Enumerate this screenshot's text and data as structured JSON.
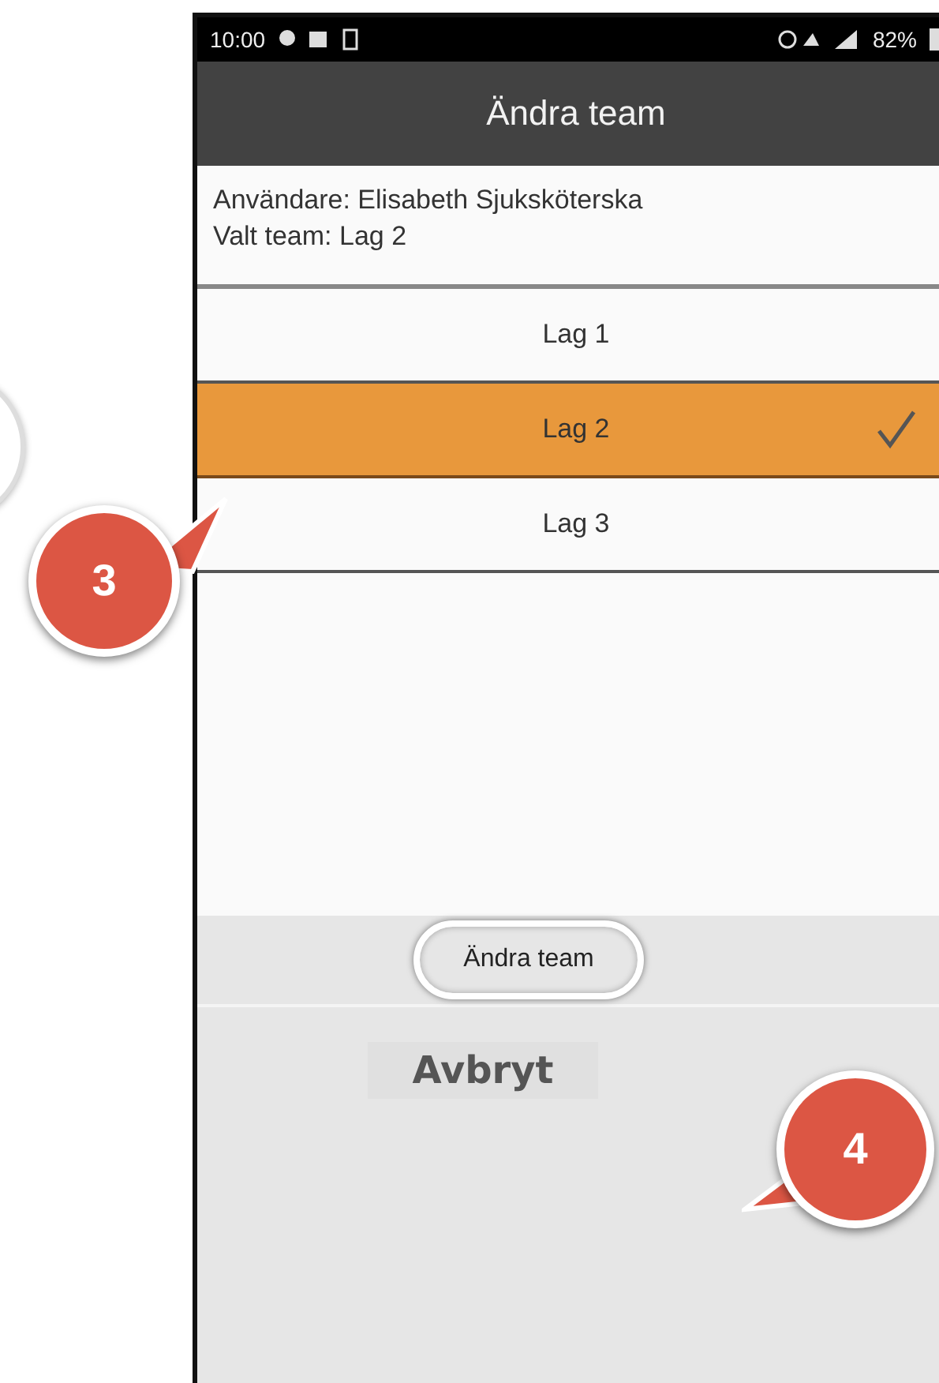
{
  "status_bar": {
    "time": "10:00",
    "battery": "82%"
  },
  "title_bar": {
    "title": "Ändra team"
  },
  "info": {
    "user": "Användare: Elisabeth Sjuksköterska",
    "team": "Valt team: Lag 2"
  },
  "teams": [
    {
      "label": "Lag 1",
      "selected": false
    },
    {
      "label": "Lag 2",
      "selected": true
    },
    {
      "label": "Lag 3",
      "selected": false
    }
  ],
  "buttons": {
    "primary": "Ändra team",
    "cancel": "Avbryt"
  },
  "callouts": [
    {
      "number": "3",
      "kind": "left"
    },
    {
      "number": "4",
      "kind": "right"
    }
  ]
}
